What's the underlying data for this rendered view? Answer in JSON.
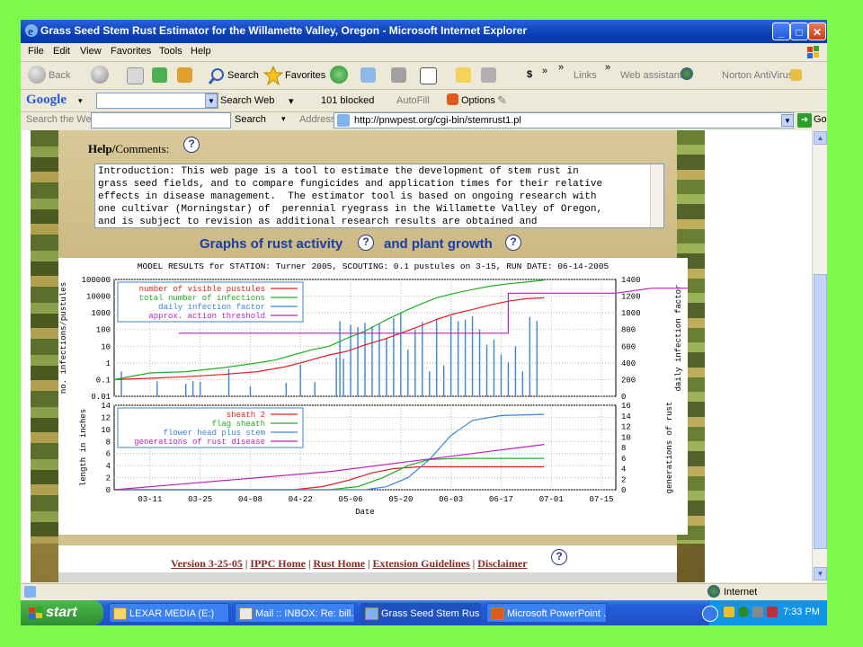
{
  "window": {
    "title": "Grass Seed Stem Rust Estimator for the Willamette Valley, Oregon - Microsoft Internet Explorer",
    "minimize": "_",
    "maximize": "□",
    "close": "✕"
  },
  "menu": [
    "File",
    "Edit",
    "View",
    "Favorites",
    "Tools",
    "Help"
  ],
  "toolbar": {
    "back": "Back",
    "search": "Search",
    "favorites": "Favorites",
    "links": "Links",
    "links_chevron": "»",
    "web_assistant": "Web assistant",
    "norton": "Norton AntiVirus"
  },
  "google_bar": {
    "logo": "Google",
    "search_web": "Search Web",
    "blocked": "101 blocked",
    "autofill": "AutoFill",
    "options": "Options"
  },
  "address_bar": {
    "search_the_web": "Search the Web",
    "search_button": "Search",
    "address_label": "Address",
    "url": "http://pnwpest.org/cgi-bin/stemrust1.pl",
    "go": "Go"
  },
  "page": {
    "help_label": "Help/",
    "help_label2": "Comments",
    "help_label_colon": ":",
    "help_text": [
      "Introduction: This web page is a tool to estimate the development of stem rust in",
      "grass seed fields, and to compare fungicides and application times for their relative",
      "effects in disease management.  The estimator tool is based on ongoing research with",
      "one cultivar (Morningstar) of  perennial ryegrass in the Willamette Valley of Oregon,",
      "and is subject to revision as additional research results are obtained and"
    ],
    "graphs_title_1": "Graphs of rust activity",
    "graphs_title_2": "and plant growth",
    "qmark": "?",
    "links": [
      "Version 3-25-05",
      "IPPC Home",
      "Rust Home",
      "Extension Guidelines",
      "Disclaimer"
    ],
    "link_sep": "|"
  },
  "chart_data": [
    {
      "type": "line",
      "title": "MODEL RESULTS for STATION: Turner 2005, SCOUTING: 0.1 pustules on 3-15, RUN DATE: 06-14-2005",
      "ylabel": "no. infections/pustules",
      "y2label": "daily infection factor",
      "yscale": "log",
      "ylim": [
        0.01,
        100000
      ],
      "y_ticks": [
        "100000",
        "10000",
        "1000",
        "100",
        "10",
        "1",
        "0.1",
        "0.01"
      ],
      "y2lim": [
        0,
        1400
      ],
      "y2_ticks": [
        "1400",
        "1200",
        "1000",
        "800",
        "600",
        "400",
        "200",
        "0"
      ],
      "legend": [
        "number of visible pustules",
        "total number of infections",
        "daily infection factor",
        "approx. action threshold"
      ],
      "legend_position": "top-left",
      "series_colors": [
        "#e02020",
        "#20b020",
        "#3a86d8",
        "#c020c0"
      ],
      "x_start": "2005-03-01",
      "series": [
        {
          "name": "number of visible pustules",
          "points": [
            [
              0,
              0.1
            ],
            [
              10,
              0.12
            ],
            [
              20,
              0.15
            ],
            [
              30,
              0.2
            ],
            [
              40,
              0.3
            ],
            [
              48,
              0.6
            ],
            [
              55,
              1.5
            ],
            [
              60,
              3
            ],
            [
              65,
              5
            ],
            [
              70,
              12
            ],
            [
              75,
              25
            ],
            [
              80,
              60
            ],
            [
              85,
              150
            ],
            [
              90,
              400
            ],
            [
              95,
              900
            ],
            [
              100,
              1600
            ],
            [
              105,
              3000
            ],
            [
              110,
              5000
            ],
            [
              115,
              7000
            ],
            [
              120,
              8000
            ]
          ]
        },
        {
          "name": "total number of infections",
          "points": [
            [
              0,
              0.1
            ],
            [
              10,
              0.25
            ],
            [
              20,
              0.3
            ],
            [
              30,
              0.5
            ],
            [
              40,
              1
            ],
            [
              45,
              1.5
            ],
            [
              50,
              3
            ],
            [
              55,
              6
            ],
            [
              60,
              10
            ],
            [
              65,
              30
            ],
            [
              70,
              80
            ],
            [
              75,
              300
            ],
            [
              80,
              1000
            ],
            [
              85,
              3000
            ],
            [
              90,
              8000
            ],
            [
              95,
              15000
            ],
            [
              100,
              25000
            ],
            [
              105,
              40000
            ],
            [
              110,
              55000
            ],
            [
              115,
              70000
            ],
            [
              120,
              90000
            ]
          ]
        },
        {
          "name": "approx. action threshold",
          "points": [
            [
              18,
              60
            ],
            [
              110,
              60
            ],
            [
              110,
              15000
            ],
            [
              140,
              15000
            ],
            [
              150,
              30000
            ],
            [
              180,
              30000
            ]
          ]
        }
      ],
      "daily_infection_factor_bars": [
        [
          2,
          300
        ],
        [
          12,
          180
        ],
        [
          20,
          150
        ],
        [
          22,
          180
        ],
        [
          24,
          170
        ],
        [
          32,
          330
        ],
        [
          38,
          120
        ],
        [
          48,
          160
        ],
        [
          52,
          380
        ],
        [
          56,
          170
        ],
        [
          62,
          460
        ],
        [
          63,
          900
        ],
        [
          64,
          450
        ],
        [
          66,
          860
        ],
        [
          68,
          830
        ],
        [
          70,
          880
        ],
        [
          72,
          840
        ],
        [
          74,
          870
        ],
        [
          76,
          700
        ],
        [
          78,
          940
        ],
        [
          80,
          1000
        ],
        [
          82,
          560
        ],
        [
          84,
          800
        ],
        [
          86,
          890
        ],
        [
          88,
          300
        ],
        [
          90,
          930
        ],
        [
          92,
          370
        ],
        [
          94,
          960
        ],
        [
          96,
          900
        ],
        [
          98,
          920
        ],
        [
          100,
          960
        ],
        [
          102,
          800
        ],
        [
          104,
          620
        ],
        [
          106,
          680
        ],
        [
          108,
          500
        ],
        [
          110,
          410
        ],
        [
          112,
          600
        ],
        [
          114,
          300
        ],
        [
          116,
          950
        ],
        [
          118,
          900
        ]
      ]
    },
    {
      "type": "line",
      "xlabel": "Date",
      "x_ticks": [
        "03-11",
        "03-25",
        "04-08",
        "04-22",
        "05-06",
        "05-20",
        "06-03",
        "06-17",
        "07-01",
        "07-15"
      ],
      "ylabel": "length in inches",
      "y2label": "generations of rust",
      "ylim": [
        0,
        14
      ],
      "y_ticks": [
        "14",
        "12",
        "10",
        "8",
        "6",
        "4",
        "2",
        "0"
      ],
      "y2lim": [
        0,
        16
      ],
      "y2_ticks": [
        "16",
        "14",
        "12",
        "10",
        "8",
        "6",
        "4",
        "2",
        "0"
      ],
      "legend": [
        "sheath 2",
        "flag sheath",
        "flower head plus stem",
        "generations of rust disease"
      ],
      "legend_position": "top-left",
      "series_colors": [
        "#e02020",
        "#20b020",
        "#3a86d8",
        "#c020c0"
      ],
      "x_start": "2005-03-01",
      "series": [
        {
          "name": "sheath 2",
          "points": [
            [
              0,
              0
            ],
            [
              50,
              0
            ],
            [
              58,
              0.5
            ],
            [
              65,
              1.5
            ],
            [
              72,
              2.8
            ],
            [
              78,
              3.5
            ],
            [
              85,
              3.8
            ],
            [
              120,
              3.8
            ]
          ]
        },
        {
          "name": "flag sheath",
          "points": [
            [
              0,
              0
            ],
            [
              60,
              0
            ],
            [
              68,
              0.5
            ],
            [
              75,
              2
            ],
            [
              82,
              4
            ],
            [
              88,
              5
            ],
            [
              95,
              5.2
            ],
            [
              120,
              5.2
            ]
          ]
        },
        {
          "name": "flower head plus stem",
          "points": [
            [
              0,
              0
            ],
            [
              70,
              0
            ],
            [
              76,
              0.5
            ],
            [
              82,
              2
            ],
            [
              88,
              5
            ],
            [
              94,
              9
            ],
            [
              100,
              11.5
            ],
            [
              108,
              12.3
            ],
            [
              120,
              12.5
            ]
          ]
        },
        {
          "name": "generations of rust disease",
          "points": [
            [
              0,
              0
            ],
            [
              20,
              1
            ],
            [
              40,
              2
            ],
            [
              60,
              3
            ],
            [
              80,
              4.5
            ],
            [
              100,
              6
            ],
            [
              120,
              7.5
            ]
          ]
        }
      ]
    }
  ],
  "status": {
    "internet": "Internet"
  },
  "taskbar": {
    "start": "start",
    "tasks": [
      "LEXAR MEDIA (E:)",
      "Mail :: INBOX: Re: bill...",
      "Grass Seed Stem Rus...",
      "Microsoft PowerPoint ..."
    ],
    "time": "7:33 PM"
  }
}
